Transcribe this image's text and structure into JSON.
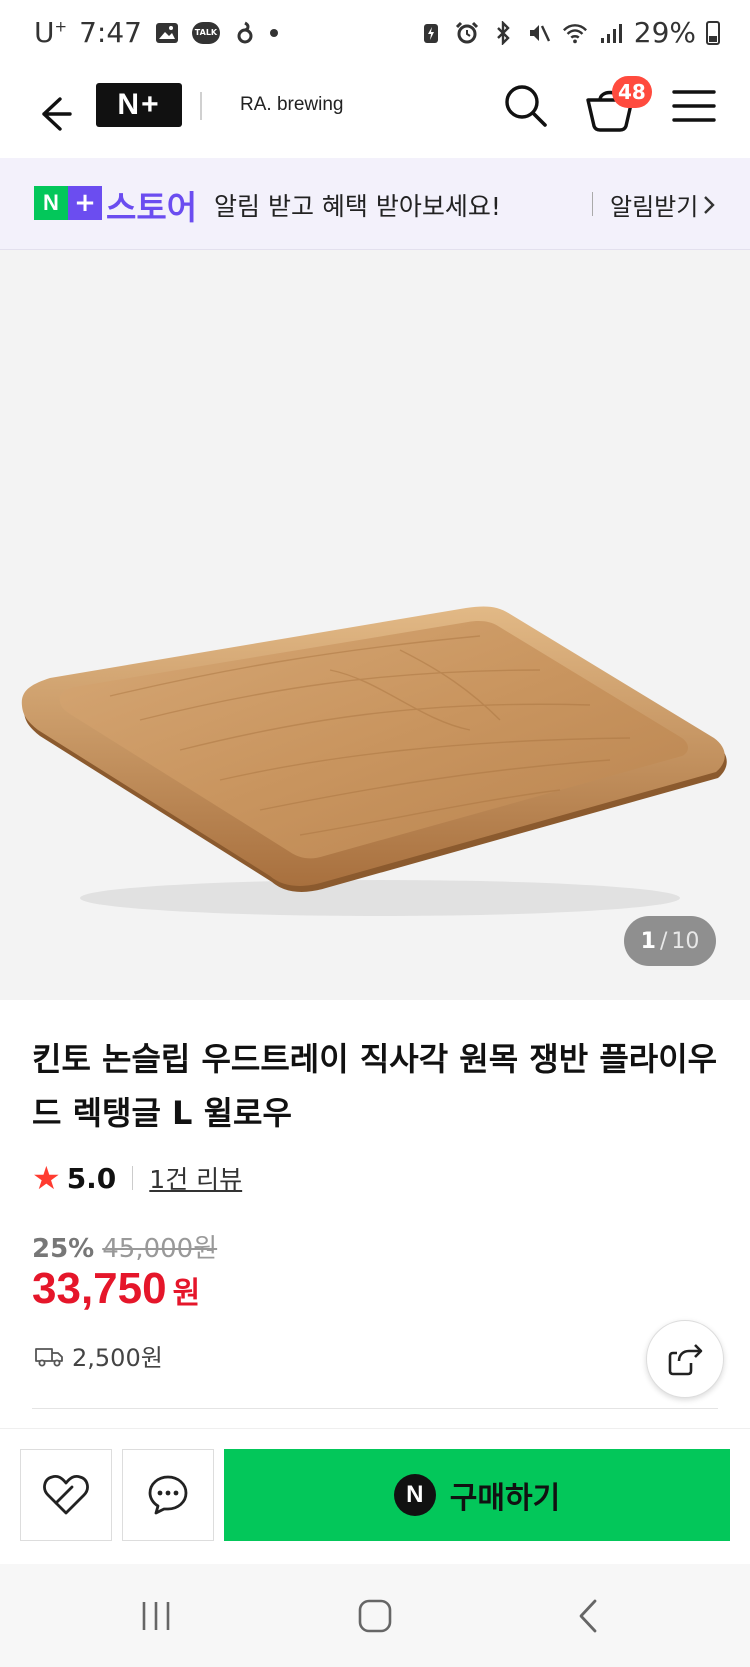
{
  "status_bar": {
    "carrier": "U",
    "carrier_sup": "+",
    "time": "7:47",
    "talk_label": "TALK",
    "battery_percent": "29%"
  },
  "header": {
    "logo_text": "N+",
    "store_name": "RA. brewing",
    "cart_count": "48"
  },
  "banner": {
    "logo_n": "N",
    "logo_plus": "+",
    "store_label": "스토어",
    "message": "알림 받고 혜택 받아보세요!",
    "action_label": "알림받기"
  },
  "gallery": {
    "current": "1",
    "separator": "/",
    "total": "10"
  },
  "product": {
    "title": "킨토 논슬립 우드트레이 직사각 원목 쟁반 플라이우드 렉탱글 L 윌로우",
    "rating": "5.0",
    "review_link": "1건 리뷰",
    "discount_rate": "25%",
    "original_price": "45,000원",
    "sale_price": "33,750",
    "price_unit": "원",
    "shipping_fee": "2,500원"
  },
  "actions": {
    "buy_icon_text": "N",
    "buy_label": "구매하기"
  },
  "colors": {
    "naver_green": "#03c75a",
    "naver_purple": "#6b4df0",
    "price_red": "#e5162a",
    "badge_red": "#ff4b3e"
  }
}
